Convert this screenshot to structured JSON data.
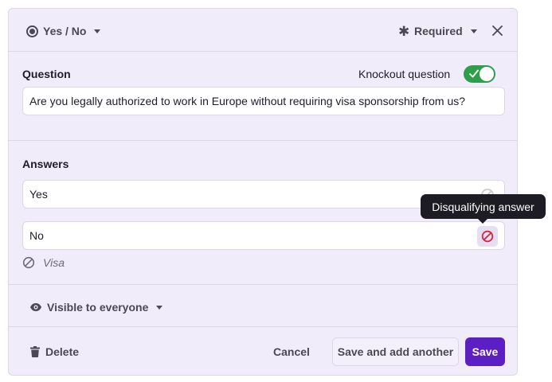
{
  "header": {
    "type_label": "Yes / No",
    "type_icon": "radio-button-icon",
    "required_label": "Required",
    "required_icon": "asterisk-icon",
    "close_icon": "close-icon"
  },
  "question": {
    "label": "Question",
    "knockout_label": "Knockout question",
    "knockout_enabled": true,
    "text": "Are you legally authorized to work in Europe without requiring visa sponsorship from us?"
  },
  "answers": {
    "label": "Answers",
    "items": [
      {
        "value": "Yes",
        "disqualifying": false
      },
      {
        "value": "No",
        "disqualifying": true
      }
    ],
    "tooltip": "Disqualifying answer",
    "note": "Visa"
  },
  "visibility": {
    "label": "Visible to everyone",
    "icon": "eye-icon"
  },
  "footer": {
    "delete_label": "Delete",
    "cancel_label": "Cancel",
    "save_another_label": "Save and add another",
    "save_label": "Save"
  },
  "colors": {
    "card_bg": "#f1ecfa",
    "primary": "#5b1fc4",
    "toggle_on": "#2f9d4a",
    "disqualify_red": "#d6263f",
    "tooltip_bg": "#1d1b23"
  }
}
